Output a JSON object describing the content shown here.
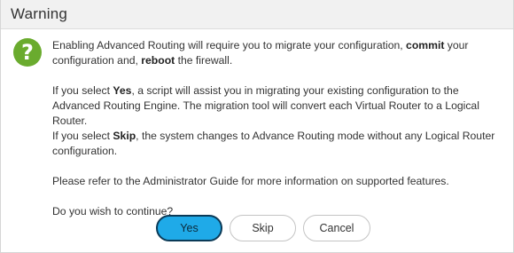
{
  "dialog": {
    "title": "Warning",
    "icon": "question-icon",
    "icon_color": "#6aab2e"
  },
  "message": {
    "p1": {
      "t1": "Enabling Advanced Routing will require you to migrate your configuration, ",
      "b1": "commit",
      "t2": " your configuration and, ",
      "b2": "reboot",
      "t3": " the firewall."
    },
    "p2": {
      "t1": "If you select ",
      "b1": "Yes",
      "t2": ", a script will assist you in migrating your existing configuration to the Advanced Routing Engine. The migration tool will convert each Virtual Router to a Logical Router."
    },
    "p3": {
      "t1": "If you select ",
      "b1": "Skip",
      "t2": ", the system changes to Advance Routing mode without any Logical Router configuration."
    },
    "p4": "Please refer to the Administrator Guide for more information on supported features.",
    "p5": "Do you wish to continue?"
  },
  "buttons": {
    "yes": "Yes",
    "skip": "Skip",
    "cancel": "Cancel"
  },
  "colors": {
    "primary_button": "#1faae8",
    "titlebar": "#f1f1f1"
  }
}
